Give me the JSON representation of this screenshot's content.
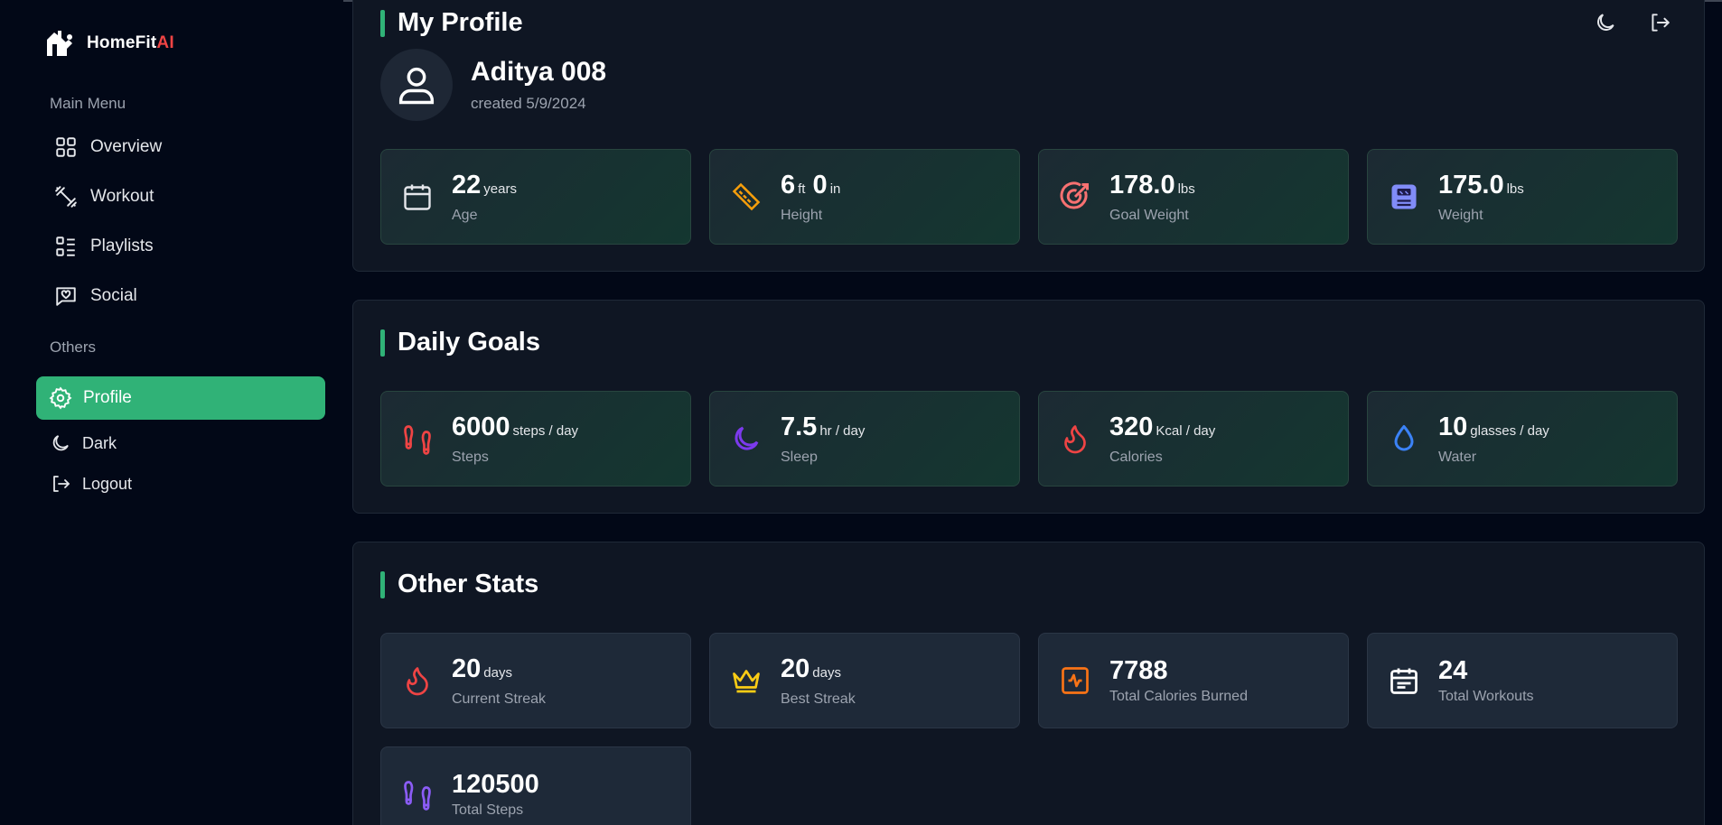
{
  "brand": {
    "name_main": "HomeFit",
    "name_accent": "AI"
  },
  "sidebar": {
    "main_menu_label": "Main Menu",
    "items": [
      {
        "label": "Overview",
        "icon": "grid-icon"
      },
      {
        "label": "Workout",
        "icon": "dumbbell-icon"
      },
      {
        "label": "Playlists",
        "icon": "list-icon"
      },
      {
        "label": "Social",
        "icon": "chat-heart-icon"
      }
    ],
    "others_label": "Others",
    "profile_label": "Profile",
    "dark_label": "Dark",
    "logout_label": "Logout"
  },
  "profile": {
    "title": "My Profile",
    "name": "Aditya 008",
    "created": "created 5/9/2024",
    "cards": [
      {
        "value": "22",
        "unit": "years",
        "label": "Age",
        "icon": "calendar-icon",
        "color": "#e5e7eb"
      },
      {
        "value_ft": "6",
        "unit_ft": "ft",
        "value_in": "0",
        "unit_in": "in",
        "label": "Height",
        "icon": "ruler-icon",
        "color": "#f59e0b"
      },
      {
        "value": "178.0",
        "unit": "lbs",
        "label": "Goal Weight",
        "icon": "target-icon",
        "color": "#f87171"
      },
      {
        "value": "175.0",
        "unit": "lbs",
        "label": "Weight",
        "icon": "scale-icon",
        "color": "#818cf8"
      }
    ]
  },
  "daily_goals": {
    "title": "Daily Goals",
    "cards": [
      {
        "value": "6000",
        "unit": "steps / day",
        "label": "Steps",
        "icon": "footprints-icon",
        "color": "#ef4444"
      },
      {
        "value": "7.5",
        "unit": "hr / day",
        "label": "Sleep",
        "icon": "moon-icon",
        "color": "#7c3aed"
      },
      {
        "value": "320",
        "unit": "Kcal / day",
        "label": "Calories",
        "icon": "flame-icon",
        "color": "#ef4444"
      },
      {
        "value": "10",
        "unit": "glasses / day",
        "label": "Water",
        "icon": "droplet-icon",
        "color": "#3b82f6"
      }
    ]
  },
  "other_stats": {
    "title": "Other Stats",
    "cards": [
      {
        "value": "20",
        "unit": "days",
        "label": "Current Streak",
        "icon": "flame-icon",
        "color": "#ef4444"
      },
      {
        "value": "20",
        "unit": "days",
        "label": "Best Streak",
        "icon": "crown-icon",
        "color": "#facc15"
      },
      {
        "value": "7788",
        "unit": "",
        "label": "Total Calories Burned",
        "icon": "activity-square-icon",
        "color": "#f97316"
      },
      {
        "value": "24",
        "unit": "",
        "label": "Total Workouts",
        "icon": "calendar-days-icon",
        "color": "#ffffff"
      },
      {
        "value": "120500",
        "unit": "",
        "label": "Total Steps",
        "icon": "footprints-icon",
        "color": "#8b5cf6"
      }
    ]
  }
}
